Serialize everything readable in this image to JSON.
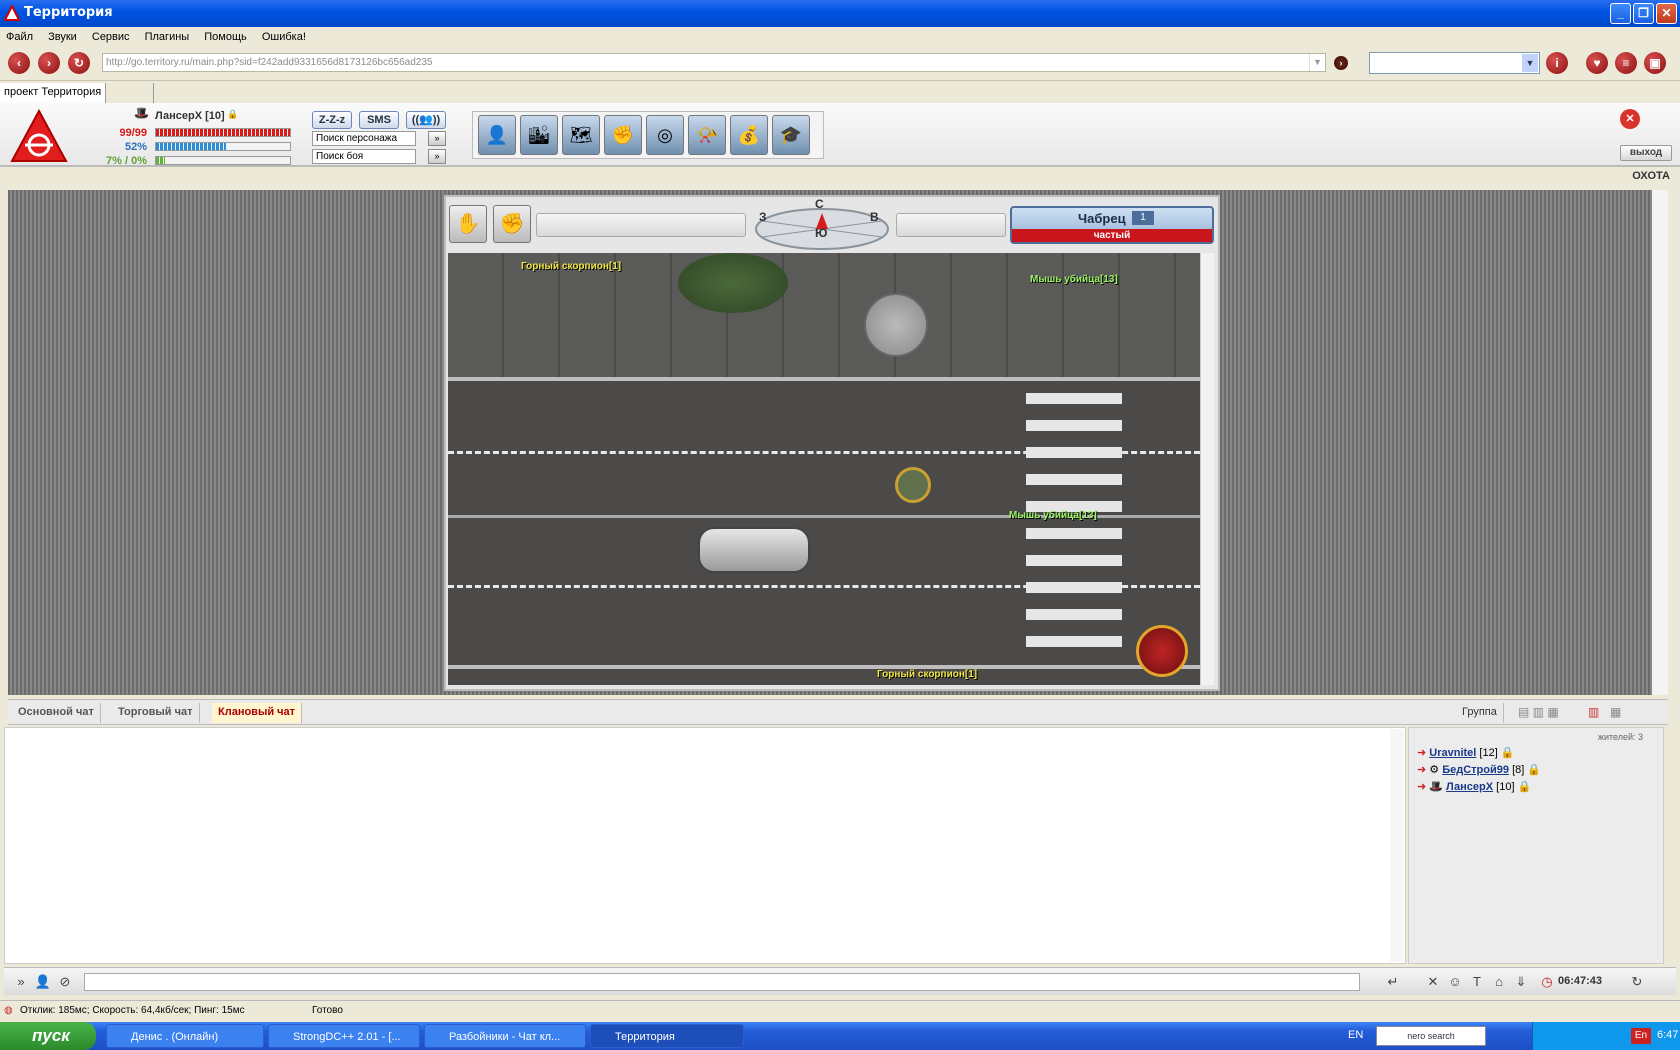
{
  "window": {
    "title": "Территория"
  },
  "menu": [
    "Файл",
    "Звуки",
    "Сервис",
    "Плагины",
    "Помощь",
    "Ошибка!"
  ],
  "url": "http://go.territory.ru/main.php?sid=f242add9331656d8173126bc656ad235",
  "tab": {
    "label": "проект Территория"
  },
  "character": {
    "name": "ЛансерХ [10]",
    "hp": "99/99",
    "hp_fraction": 1.0,
    "mp": "52%",
    "mp_fraction": 0.52,
    "xp": "7% / 0%",
    "xp_fraction": 0.07
  },
  "header_buttons": {
    "sleep": "Z-Z-z",
    "sms": "SMS"
  },
  "search": {
    "person": "Поиск персонажа",
    "battle": "Поиск боя"
  },
  "exit_label": "выход",
  "mode_label": "ОХОТА",
  "compass": {
    "n": "С",
    "s": "Ю",
    "w": "З",
    "e": "В"
  },
  "location": {
    "name": "Чабрец",
    "level": "1",
    "density": "частый"
  },
  "map_labels": [
    {
      "text": "Горный скорпион[1]",
      "cls": ""
    },
    {
      "text": "Мышь убийца[13]",
      "cls": "g"
    },
    {
      "text": "Мышь убийца[13]",
      "cls": "g"
    },
    {
      "text": "Горный скорпион[1]",
      "cls": ""
    }
  ],
  "chat_tabs": [
    "Основной чат",
    "Торговый чат",
    "Клановый чат"
  ],
  "group_label": "Группа",
  "residents": "жителей: 3",
  "users": [
    {
      "name": "Uravnitel",
      "level": "[12]"
    },
    {
      "name": "БедСтрой99",
      "level": "[8]"
    },
    {
      "name": "ЛансерХ",
      "level": "[10]"
    }
  ],
  "clock": "06:47:43",
  "status": {
    "ping": "Отклик: 185мс; Скорость: 64,4кб/сек; Пинг: 15мс",
    "ready": "Готово"
  },
  "taskbar": {
    "start": "пуск",
    "tasks": [
      "Денис . (Онлайн)",
      "StrongDC++ 2.01 - [...",
      "Разбойники - Чат кл...",
      "Территория"
    ],
    "lang": "EN",
    "search": "nero search",
    "tray_lang": "En",
    "time": "6:47"
  },
  "colors": {
    "hp": "#d61b1b",
    "mp": "#2a8fd8",
    "xp": "#62b236"
  }
}
